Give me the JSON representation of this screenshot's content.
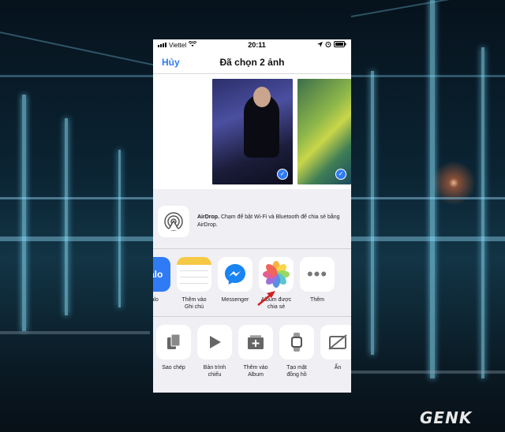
{
  "status": {
    "carrier": "Viettel",
    "time": "20:11"
  },
  "nav": {
    "cancel": "Hủy",
    "title": "Đã chọn 2 ảnh"
  },
  "airdrop": {
    "title": "AirDrop.",
    "text": " Chạm để bật Wi-Fi và Bluetooth để chia sẻ bằng AirDrop."
  },
  "apps": [
    {
      "label": "Zalo",
      "icon_text": "Zalo",
      "color": "#2f7bf6"
    },
    {
      "label": "Thêm vào\nGhi chú",
      "color": "#ffffff"
    },
    {
      "label": "Messenger",
      "color": "#ffffff"
    },
    {
      "label": "Album được\nchia sẻ",
      "color": "#ffffff"
    },
    {
      "label": "Thêm",
      "color": "#ffffff"
    }
  ],
  "actions": [
    {
      "label": "Sao chép"
    },
    {
      "label": "Bản trình\nchiếu"
    },
    {
      "label": "Thêm vào\nAlbum"
    },
    {
      "label": "Tạo mặt\nđồng hồ"
    },
    {
      "label": "Ẩn"
    }
  ],
  "watermark": "GENK",
  "colors": {
    "accent": "#2f7bf6",
    "arrow": "#d21f1f"
  }
}
